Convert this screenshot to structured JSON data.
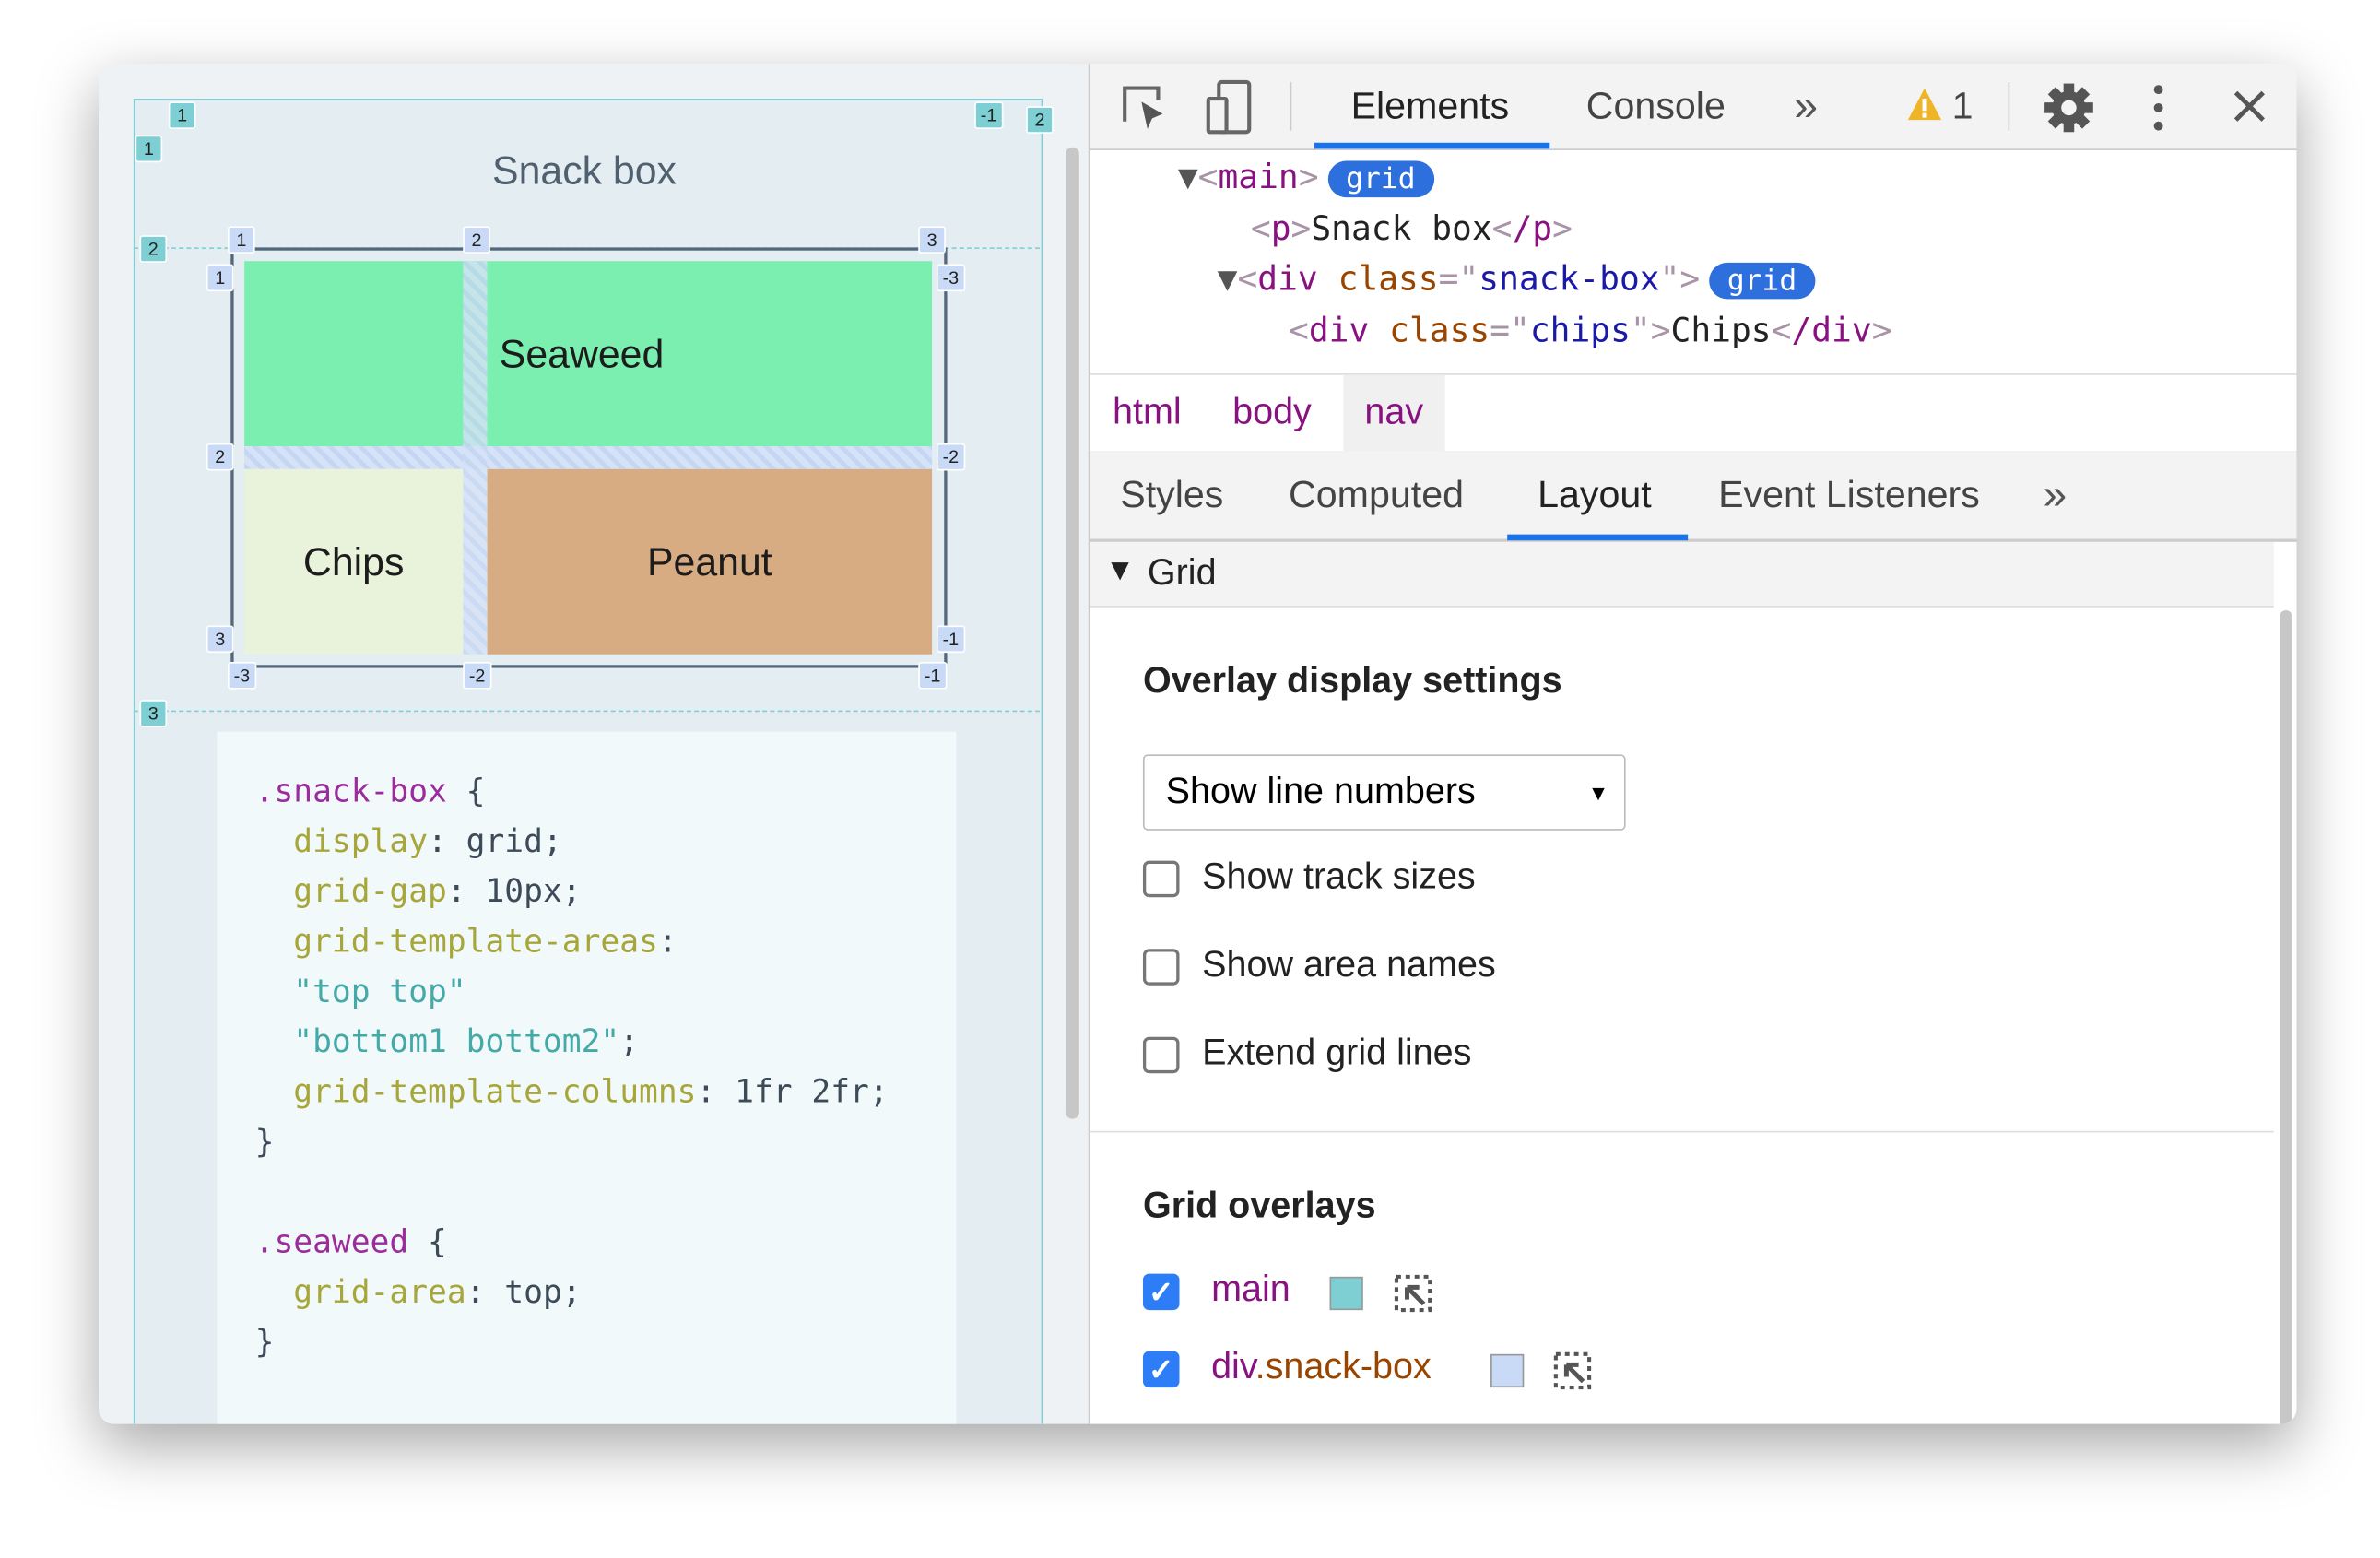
{
  "page": {
    "title": "Snack box",
    "items": {
      "seaweed": "Seaweed",
      "chips": "Chips",
      "peanut": "Peanut"
    },
    "colors": {
      "seaweed": "#7aefb0",
      "chips": "#e9f3db",
      "peanut": "#d8ac82",
      "main_overlay": "#7ecfd4",
      "snackbox_overlay": "#c9daf6"
    },
    "main_grid_labels": [
      "1",
      "1",
      "-1",
      "2",
      "2",
      "3"
    ],
    "snack_grid_labels": [
      "1",
      "2",
      "3",
      "1",
      "-3",
      "2",
      "-2",
      "3",
      "-1",
      "-3",
      "-2",
      "-1"
    ],
    "code": [
      [
        {
          "t": ".snack-box",
          "c": "sel"
        },
        {
          "t": " {",
          "c": "pl"
        }
      ],
      [
        {
          "t": "  display",
          "c": "prop"
        },
        {
          "t": ": grid;",
          "c": "pl"
        }
      ],
      [
        {
          "t": "  grid-gap",
          "c": "prop"
        },
        {
          "t": ": 10px;",
          "c": "pl"
        }
      ],
      [
        {
          "t": "  grid-template-areas",
          "c": "prop"
        },
        {
          "t": ":",
          "c": "pl"
        }
      ],
      [
        {
          "t": "  \"top top\"",
          "c": "str"
        }
      ],
      [
        {
          "t": "  \"bottom1 bottom2\"",
          "c": "str"
        },
        {
          "t": ";",
          "c": "pl"
        }
      ],
      [
        {
          "t": "  grid-template-columns",
          "c": "prop"
        },
        {
          "t": ": 1fr 2fr;",
          "c": "pl"
        }
      ],
      [
        {
          "t": "}",
          "c": "pl"
        }
      ],
      [
        {
          "t": "",
          "c": "pl"
        }
      ],
      [
        {
          "t": ".seaweed",
          "c": "sel"
        },
        {
          "t": " {",
          "c": "pl"
        }
      ],
      [
        {
          "t": "  grid-area",
          "c": "prop"
        },
        {
          "t": ": top;",
          "c": "pl"
        }
      ],
      [
        {
          "t": "}",
          "c": "pl"
        }
      ]
    ]
  },
  "devtools": {
    "toolbar": {
      "icons": [
        "inspect-element-icon",
        "device-toolbar-icon",
        "settings-gear-icon",
        "more-vertical-icon",
        "close-icon"
      ],
      "tabs": [
        "Elements",
        "Console"
      ],
      "active_tab": "Elements",
      "more": "»",
      "warning_count": "1"
    },
    "dom": {
      "main_tag": "main",
      "badge": "grid",
      "p_open": "p",
      "p_text": "Snack box",
      "p_close": "/p",
      "div_tag": "div",
      "attr": "class",
      "snack_val": "snack-box",
      "chips_val": "chips",
      "chips_text": "Chips",
      "div_close": "/div"
    },
    "breadcrumbs": [
      "html",
      "body",
      "nav"
    ],
    "subtabs": [
      "Styles",
      "Computed",
      "Layout",
      "Event Listeners"
    ],
    "active_subtab": "Layout",
    "subtabs_more": "»",
    "layout": {
      "grid_section": "Grid",
      "overlay_title": "Overlay display settings",
      "select_value": "Show line numbers",
      "options": [
        {
          "label": "Show track sizes",
          "checked": false
        },
        {
          "label": "Show area names",
          "checked": false
        },
        {
          "label": "Extend grid lines",
          "checked": false
        }
      ],
      "overlays_title": "Grid overlays",
      "overlays": [
        {
          "tag": "main",
          "cls": "",
          "checked": true,
          "color": "#7ecfd4"
        },
        {
          "tag": "div",
          "cls": ".snack-box",
          "checked": true,
          "color": "#c9daf6"
        }
      ]
    }
  }
}
